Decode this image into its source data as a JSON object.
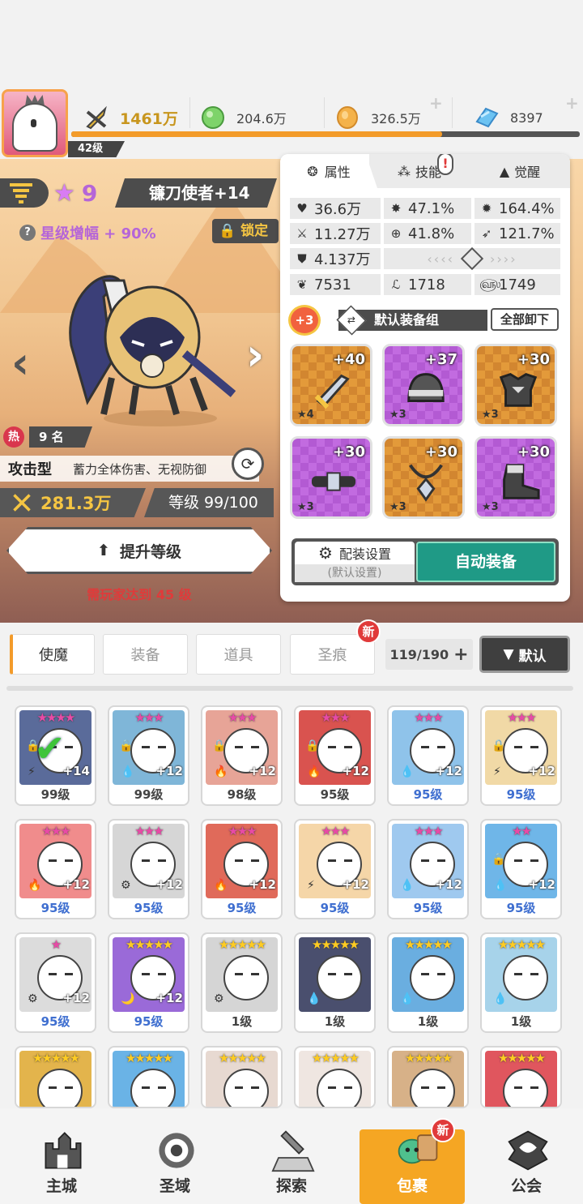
{
  "player": {
    "level": "42级"
  },
  "resources": [
    {
      "icon": "power-icon",
      "value": "1461万"
    },
    {
      "icon": "green-gem-icon",
      "value": "204.6万"
    },
    {
      "icon": "gold-coin-icon",
      "value": "326.5万"
    },
    {
      "icon": "blue-crystal-icon",
      "value": "8397"
    }
  ],
  "xp_progress": 0.73,
  "hero": {
    "stars": "9",
    "name": "镰刀使者+14",
    "star_bonus": "星级增幅 + 90%",
    "lock_label": "锁定",
    "heat_rank": "9 名",
    "heat_label": "热",
    "type": "攻击型",
    "desc": "蓄力全体伤害、无视防御",
    "power": "281.3万",
    "level_text": "等级 99/100",
    "upgrade_button": "提升等级",
    "requirement": "需玩家达到 45 级"
  },
  "panel": {
    "tabs": [
      "属性",
      "技能",
      "觉醒"
    ],
    "stats": [
      [
        {
          "icon": "heart-icon",
          "value": "36.6万"
        },
        {
          "icon": "burst-icon",
          "value": "47.1%"
        },
        {
          "icon": "sun-icon",
          "value": "164.4%"
        }
      ],
      [
        {
          "icon": "sword-icon",
          "value": "11.27万"
        },
        {
          "icon": "target-icon",
          "value": "41.8%"
        },
        {
          "icon": "wing-icon",
          "value": "121.7%"
        }
      ],
      [
        {
          "icon": "shield-icon",
          "value": "4.137万"
        }
      ],
      [
        {
          "icon": "swirl-icon",
          "value": "7531"
        },
        {
          "icon": "boot-icon",
          "value": "1718"
        },
        {
          "icon": "spiral-icon",
          "value": "1749"
        }
      ]
    ],
    "set_bonus": "+3",
    "equip_group": "默认装备组",
    "unequip_all": "全部卸下",
    "equipment": [
      {
        "item": "sword",
        "level": "+40",
        "stars": "★4",
        "color": "orange"
      },
      {
        "item": "helmet",
        "level": "+37",
        "stars": "★3",
        "color": "purple"
      },
      {
        "item": "armor",
        "level": "+30",
        "stars": "★3",
        "color": "orange"
      },
      {
        "item": "belt",
        "level": "+30",
        "stars": "★3",
        "color": "purple"
      },
      {
        "item": "necklace",
        "level": "+30",
        "stars": "★3",
        "color": "orange"
      },
      {
        "item": "boots",
        "level": "+30",
        "stars": "★3",
        "color": "purple"
      }
    ],
    "config_label": "配装设置",
    "config_sub": "(默认设置)",
    "auto_equip": "自动装备"
  },
  "inventory": {
    "tabs": [
      "使魔",
      "装备",
      "道具",
      "圣痕"
    ],
    "new_badge": "新",
    "count": "119/190",
    "sort": "默认"
  },
  "cards": [
    {
      "stars": "★★★★",
      "gold": false,
      "plus": "+14",
      "level": "99级",
      "bg": "#5a6b9a",
      "elem": "⚡",
      "lock": true,
      "check": true
    },
    {
      "stars": "★★★",
      "gold": false,
      "plus": "+12",
      "level": "99级",
      "bg": "#7fb6d8",
      "elem": "💧",
      "lock": true
    },
    {
      "stars": "★★★",
      "gold": false,
      "plus": "+12",
      "level": "98级",
      "bg": "#e7a497",
      "elem": "🔥",
      "lock": true
    },
    {
      "stars": "★★★",
      "gold": false,
      "plus": "+12",
      "level": "95级",
      "bg": "#d9534f",
      "elem": "🔥",
      "lock": true
    },
    {
      "stars": "★★★",
      "gold": false,
      "plus": "+12",
      "level": "95级",
      "bg": "#8fc3ea",
      "elem": "💧"
    },
    {
      "stars": "★★★",
      "gold": false,
      "plus": "+12",
      "level": "95级",
      "bg": "#f1d9a6",
      "elem": "⚡",
      "lock": true
    },
    {
      "stars": "★★★",
      "gold": false,
      "plus": "+12",
      "level": "95级",
      "bg": "#f08c8c",
      "elem": "🔥"
    },
    {
      "stars": "★★★",
      "gold": false,
      "plus": "+12",
      "level": "95级",
      "bg": "#d6d6d6",
      "elem": "⚙"
    },
    {
      "stars": "★★★",
      "gold": false,
      "plus": "+12",
      "level": "95级",
      "bg": "#e06a5a",
      "elem": "🔥"
    },
    {
      "stars": "★★★",
      "gold": false,
      "plus": "+12",
      "level": "95级",
      "bg": "#f5d6a8",
      "elem": "⚡"
    },
    {
      "stars": "★★★",
      "gold": false,
      "plus": "+12",
      "level": "95级",
      "bg": "#9fc9ef",
      "elem": "💧"
    },
    {
      "stars": "★★",
      "gold": false,
      "plus": "+12",
      "level": "95级",
      "bg": "#6fb6e8",
      "elem": "💧",
      "lock": true
    },
    {
      "stars": "★",
      "gold": false,
      "plus": "+12",
      "level": "95级",
      "bg": "#dcdcdc",
      "elem": "⚙"
    },
    {
      "stars": "★★★★★",
      "gold": true,
      "plus": "+12",
      "level": "95级",
      "bg": "#9a6ad8",
      "elem": "🌙"
    },
    {
      "stars": "★★★★★",
      "gold": true,
      "plus": "",
      "level": "1级",
      "bg": "#d5d5d5",
      "elem": "⚙"
    },
    {
      "stars": "★★★★★",
      "gold": true,
      "plus": "",
      "level": "1级",
      "bg": "#4a4f6e",
      "elem": "💧"
    },
    {
      "stars": "★★★★★",
      "gold": true,
      "plus": "",
      "level": "1级",
      "bg": "#6aaee0",
      "elem": "💧"
    },
    {
      "stars": "★★★★★",
      "gold": true,
      "plus": "",
      "level": "1级",
      "bg": "#a7d3ea",
      "elem": "💧"
    },
    {
      "stars": "★★★★★",
      "gold": true,
      "plus": "",
      "level": "",
      "bg": "#e3b44c",
      "elem": ""
    },
    {
      "stars": "★★★★★",
      "gold": true,
      "plus": "",
      "level": "",
      "bg": "#6ab3e6",
      "elem": ""
    },
    {
      "stars": "★★★★★",
      "gold": true,
      "plus": "",
      "level": "",
      "bg": "#e7d9d1",
      "elem": ""
    },
    {
      "stars": "★★★★★",
      "gold": true,
      "plus": "",
      "level": "",
      "bg": "#efe6e1",
      "elem": ""
    },
    {
      "stars": "★★★★★",
      "gold": true,
      "plus": "",
      "level": "",
      "bg": "#d7b188",
      "elem": ""
    },
    {
      "stars": "★★★★★",
      "gold": true,
      "plus": "",
      "level": "",
      "bg": "#e0565e",
      "elem": ""
    }
  ],
  "nav": [
    {
      "label": "主城",
      "icon": "castle-icon"
    },
    {
      "label": "圣域",
      "icon": "vortex-icon"
    },
    {
      "label": "探索",
      "icon": "sword-stone-icon"
    },
    {
      "label": "包裹",
      "icon": "bag-icon",
      "active": true,
      "badge": "新"
    },
    {
      "label": "公会",
      "icon": "guild-icon"
    }
  ],
  "colors": {
    "accent": "#f39b2a",
    "green": "#1f9a86",
    "active_nav": "#f5a623"
  }
}
